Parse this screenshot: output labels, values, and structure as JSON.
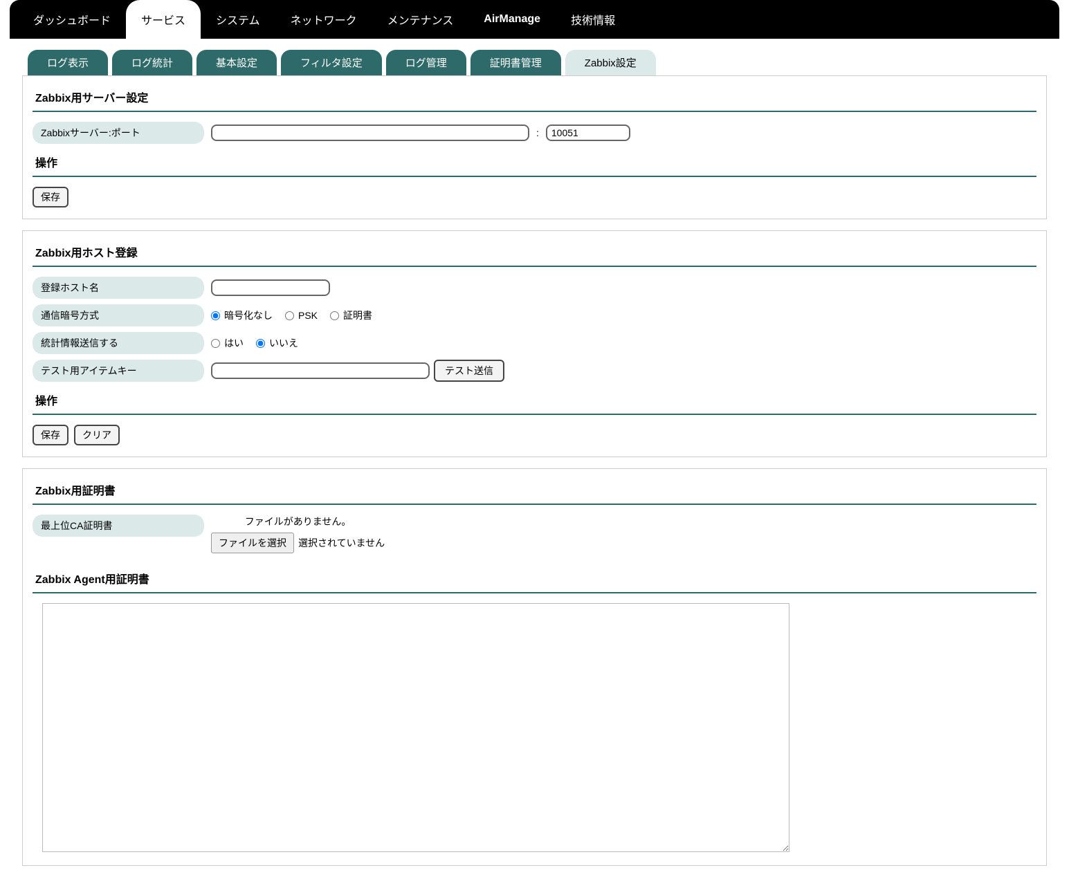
{
  "topnav": {
    "items": [
      {
        "label": "ダッシュボード"
      },
      {
        "label": "サービス"
      },
      {
        "label": "システム"
      },
      {
        "label": "ネットワーク"
      },
      {
        "label": "メンテナンス"
      },
      {
        "label": "AirManage"
      },
      {
        "label": "技術情報"
      }
    ]
  },
  "subnav": {
    "items": [
      {
        "label": "ログ表示"
      },
      {
        "label": "ログ統計"
      },
      {
        "label": "基本設定"
      },
      {
        "label": "フィルタ設定"
      },
      {
        "label": "ログ管理"
      },
      {
        "label": "証明書管理"
      },
      {
        "label": "Zabbix設定"
      }
    ]
  },
  "server": {
    "title": "Zabbix用サーバー設定",
    "server_label": "Zabbixサーバー:ポート",
    "server_value": "",
    "colon": ":",
    "port_value": "10051",
    "ops_title": "操作",
    "save": "保存"
  },
  "host": {
    "title": "Zabbix用ホスト登録",
    "hostname_label": "登録ホスト名",
    "hostname_value": "",
    "enc_label": "通信暗号方式",
    "enc_none": "暗号化なし",
    "enc_psk": "PSK",
    "enc_cert": "証明書",
    "stats_label": "統計情報送信する",
    "stats_yes": "はい",
    "stats_no": "いいえ",
    "itemkey_label": "テスト用アイテムキー",
    "itemkey_value": "",
    "test_btn": "テスト送信",
    "ops_title": "操作",
    "save": "保存",
    "clear": "クリア"
  },
  "cert": {
    "title": "Zabbix用証明書",
    "ca_label": "最上位CA証明書",
    "nofile": "ファイルがありません。",
    "choose": "ファイルを選択",
    "notselected": "選択されていません",
    "agent_title": "Zabbix Agent用証明書",
    "agent_value": ""
  }
}
